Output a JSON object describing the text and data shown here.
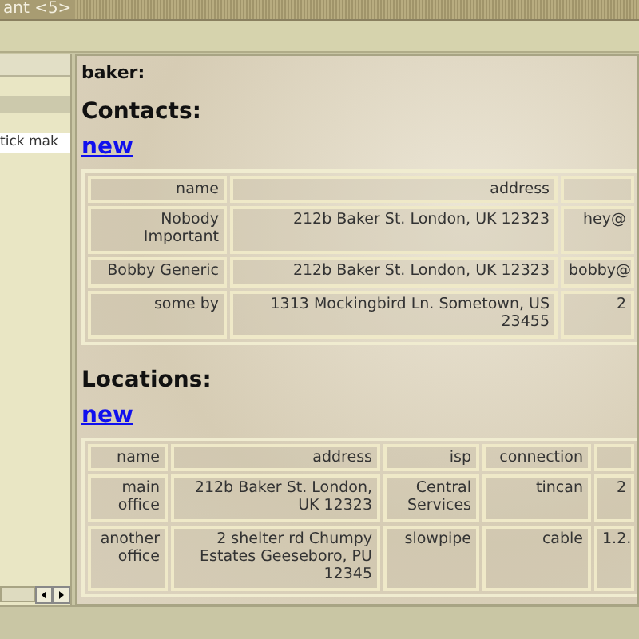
{
  "window": {
    "title": "ant <5>"
  },
  "sidebar": {
    "items": [
      {
        "label": "tick mak",
        "selected": true
      }
    ]
  },
  "main": {
    "user": "baker:",
    "sections": [
      {
        "title": "Contacts:",
        "new_link": "new",
        "table": {
          "columns": [
            "name",
            "address"
          ],
          "rows": [
            [
              "Nobody Important",
              "212b Baker St. London, UK 12323",
              "hey@"
            ],
            [
              "Bobby Generic",
              "212b Baker St. London, UK 12323",
              "bobby@"
            ],
            [
              "some by",
              "1313 Mockingbird Ln. Sometown, US 23455",
              "2"
            ]
          ]
        }
      },
      {
        "title": "Locations:",
        "new_link": "new",
        "table": {
          "columns": [
            "name",
            "address",
            "isp",
            "connection"
          ],
          "rows": [
            [
              "main office",
              "212b Baker St. London, UK 12323",
              "Central Services",
              "tincan",
              "2"
            ],
            [
              "another office",
              "2 shelter rd Chumpy Estates Geeseboro, PU 12345",
              "slowpipe",
              "cable",
              "1.2."
            ]
          ]
        }
      }
    ]
  }
}
